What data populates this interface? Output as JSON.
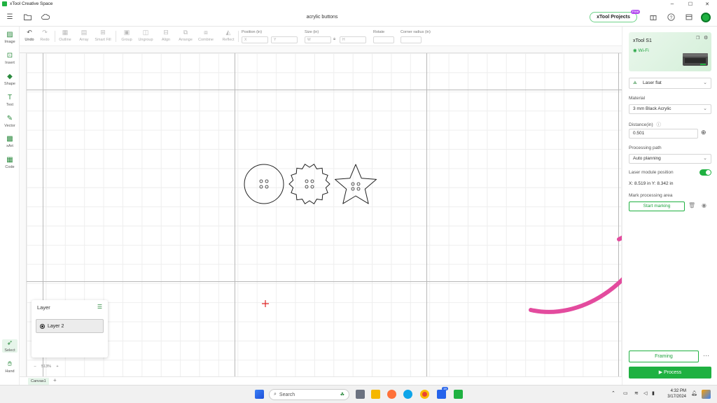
{
  "window": {
    "title": "xTool Creative Space",
    "minimize": "–",
    "maximize": "☐",
    "close": "✕"
  },
  "menubar": {
    "document_title": "acrylic buttons",
    "projects_label": "xTool Projects",
    "projects_badge": "Free"
  },
  "toolbar": {
    "undo": "Undo",
    "redo": "Redo",
    "outline": "Outline",
    "array": "Array",
    "smart_fill": "Smart Fill",
    "group": "Group",
    "ungroup": "Ungroup",
    "align": "Align",
    "arrange": "Arrange",
    "combine": "Combine",
    "reflect": "Reflect",
    "position_label": "Position (in)",
    "x_placeholder": "X",
    "y_placeholder": "Y",
    "size_label": "Size (in)",
    "w_placeholder": "W",
    "h_placeholder": "H",
    "rotate_label": "Rotate",
    "corner_label": "Corner radius (in)"
  },
  "leftpanel": {
    "items": [
      "Image",
      "Insert",
      "Shape",
      "Text",
      "Vector",
      "xArt",
      "Code"
    ],
    "select": "Select",
    "hand": "Hand"
  },
  "layer": {
    "title": "Layer",
    "name": "Layer 2"
  },
  "zoom": {
    "minus": "–",
    "value": "513%",
    "plus": "+"
  },
  "canvas_tabs": {
    "active": "Canvas1",
    "add": "+"
  },
  "rightpanel": {
    "device_name": "xTool S1",
    "wifi": "Wi-Fi",
    "mode": "Laser flat",
    "material_label": "Material",
    "material_value": "3 mm Black Acrylic",
    "distance_label": "Distance(in)",
    "distance_value": "0.501",
    "processing_path_label": "Processing path",
    "processing_path_value": "Auto planning",
    "laser_module_label": "Laser module position",
    "laser_module_enabled": true,
    "coords": "X: 8.519 in   Y: 8.342 in",
    "mark_area_label": "Mark processing area",
    "start_marking": "Start marking",
    "framing": "Framing",
    "more": "···",
    "process": "Process"
  },
  "taskbar": {
    "search": "Search",
    "time": "4:32 PM",
    "date": "3/17/2024",
    "badge": "16"
  },
  "colors": {
    "accent": "#1fb141",
    "annotation_arrow": "#e34b9e"
  }
}
